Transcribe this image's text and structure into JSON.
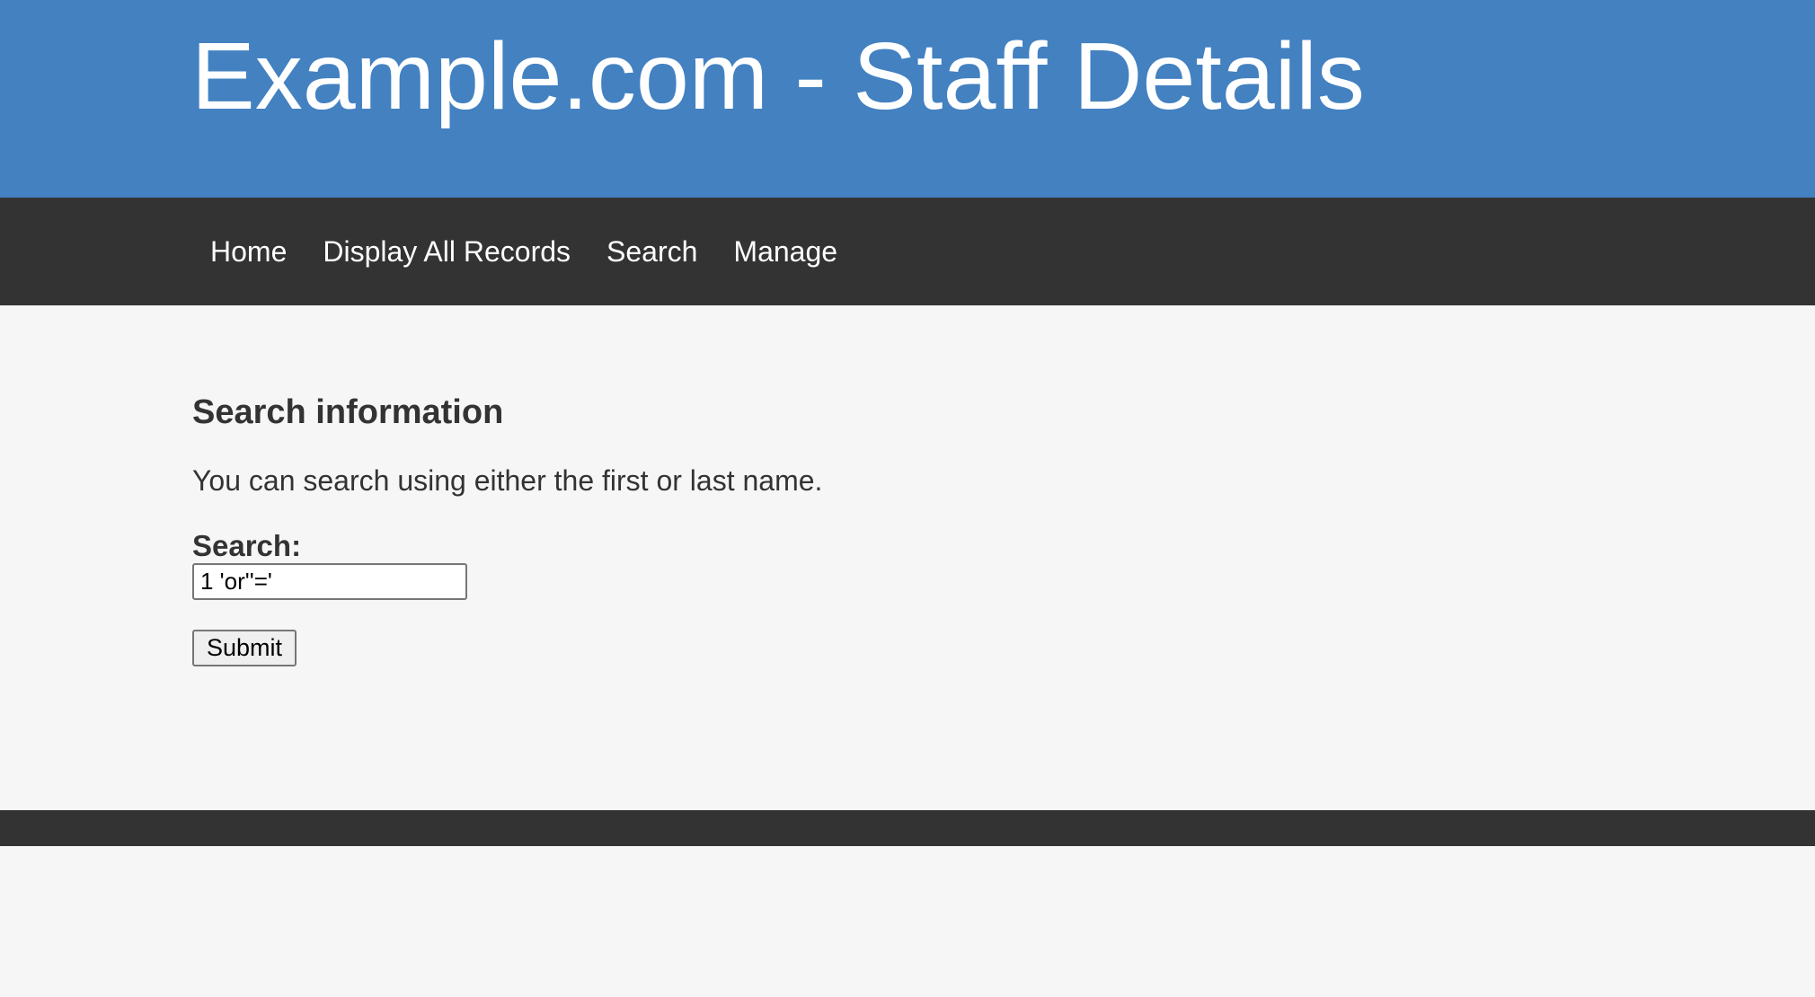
{
  "header": {
    "title": "Example.com - Staff Details"
  },
  "nav": {
    "items": [
      {
        "label": "Home"
      },
      {
        "label": "Display All Records"
      },
      {
        "label": "Search"
      },
      {
        "label": "Manage"
      }
    ]
  },
  "main": {
    "heading": "Search information",
    "help_text": "You can search using either the first or last name.",
    "search_label": "Search:",
    "search_value": "1 'or''='",
    "submit_label": "Submit"
  },
  "colors": {
    "header_bg": "#4381c1",
    "nav_bg": "#333333",
    "page_bg": "#f6f6f6",
    "footer_bg": "#333333"
  }
}
